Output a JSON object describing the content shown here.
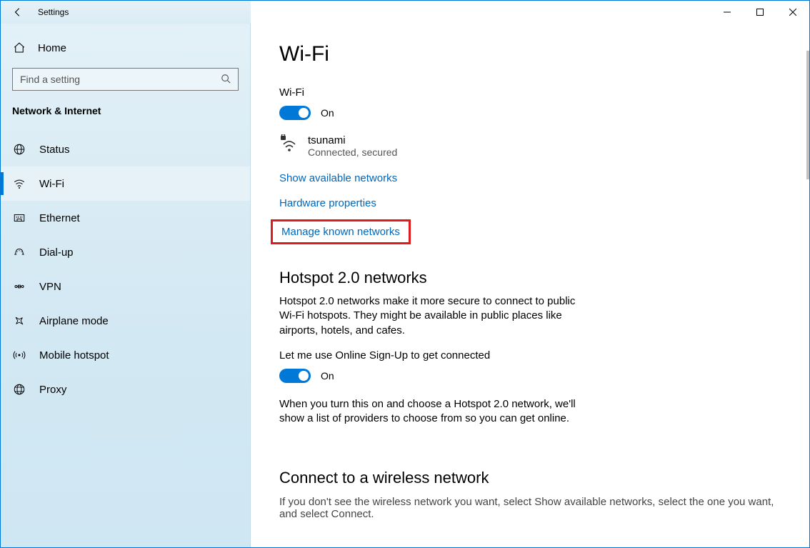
{
  "window": {
    "title": "Settings"
  },
  "sidebar": {
    "home": "Home",
    "search_placeholder": "Find a setting",
    "category": "Network & Internet",
    "items": [
      {
        "label": "Status",
        "icon": "globe"
      },
      {
        "label": "Wi-Fi",
        "icon": "wifi",
        "active": true
      },
      {
        "label": "Ethernet",
        "icon": "ethernet"
      },
      {
        "label": "Dial-up",
        "icon": "dialup"
      },
      {
        "label": "VPN",
        "icon": "vpn"
      },
      {
        "label": "Airplane mode",
        "icon": "airplane"
      },
      {
        "label": "Mobile hotspot",
        "icon": "hotspot"
      },
      {
        "label": "Proxy",
        "icon": "proxy"
      }
    ]
  },
  "main": {
    "title": "Wi-Fi",
    "wifi_section_label": "Wi-Fi",
    "wifi_toggle_state": "On",
    "current_network": {
      "ssid": "tsunami",
      "status": "Connected, secured"
    },
    "link_show_available": "Show available networks",
    "link_hardware_props": "Hardware properties",
    "link_manage_known": "Manage known networks",
    "hotspot": {
      "heading": "Hotspot 2.0 networks",
      "description": "Hotspot 2.0 networks make it more secure to connect to public Wi-Fi hotspots. They might be available in public places like airports, hotels, and cafes.",
      "online_signup_label": "Let me use Online Sign-Up to get connected",
      "online_signup_state": "On",
      "explain": "When you turn this on and choose a Hotspot 2.0 network, we'll show a list of providers to choose from so you can get online."
    },
    "connect": {
      "heading": "Connect to a wireless network",
      "hint": "If you don't see the wireless network you want, select Show available networks, select the one you want, and select Connect."
    }
  }
}
